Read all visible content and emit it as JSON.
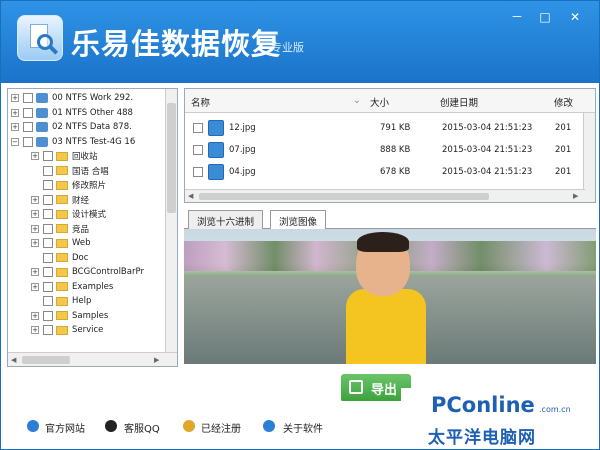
{
  "app": {
    "title": "乐易佳数据恢复",
    "edition": "专业版",
    "window_buttons": {
      "minimize": "－",
      "maximize": "□",
      "close": "✕"
    }
  },
  "tree": {
    "drives": [
      {
        "label": "00 NTFS Work 292.",
        "icon": "drive-icon"
      },
      {
        "label": "01 NTFS Other 488",
        "icon": "drive-icon"
      },
      {
        "label": "02 NTFS Data 878.",
        "icon": "drive-icon"
      },
      {
        "label": "03 NTFS Test-4G 16",
        "icon": "drive-icon"
      }
    ],
    "folders": [
      {
        "label": "回收站"
      },
      {
        "label": "国语 合唱"
      },
      {
        "label": "修改照片"
      },
      {
        "label": "财经"
      },
      {
        "label": "设计模式"
      },
      {
        "label": "竞品"
      },
      {
        "label": "Web"
      },
      {
        "label": "Doc"
      },
      {
        "label": "BCGControlBarPr"
      },
      {
        "label": "Examples"
      },
      {
        "label": "Help"
      },
      {
        "label": "Samples"
      },
      {
        "label": "Service"
      }
    ]
  },
  "files": {
    "columns": [
      "名称",
      "大小",
      "创建日期",
      "修改"
    ],
    "rows": [
      {
        "name": "12.jpg",
        "size": "791 KB",
        "created": "2015-03-04  21:51:23",
        "modified": "201"
      },
      {
        "name": "07.jpg",
        "size": "888 KB",
        "created": "2015-03-04  21:51:23",
        "modified": "201"
      },
      {
        "name": "04.jpg",
        "size": "678 KB",
        "created": "2015-03-04  21:51:23",
        "modified": "201"
      }
    ]
  },
  "tabs": [
    {
      "label": "浏览十六进制",
      "active": false
    },
    {
      "label": "浏览图像",
      "active": true
    }
  ],
  "export_button": {
    "label": "导出"
  },
  "footer": {
    "links": [
      {
        "label": "官方网站",
        "icon": "globe-icon"
      },
      {
        "label": "客服QQ",
        "icon": "qq-icon"
      },
      {
        "label": "已经注册",
        "icon": "key-icon"
      },
      {
        "label": "关于软件",
        "icon": "info-icon"
      }
    ]
  },
  "watermark": {
    "top": "PConline",
    "domain": ".com.cn",
    "bottom": "太平洋电脑网"
  },
  "colors": {
    "titlebar": "#1b73c9",
    "accent": "#2e93e6",
    "export": "#39a23a",
    "watermark": "#1d5fb3"
  }
}
